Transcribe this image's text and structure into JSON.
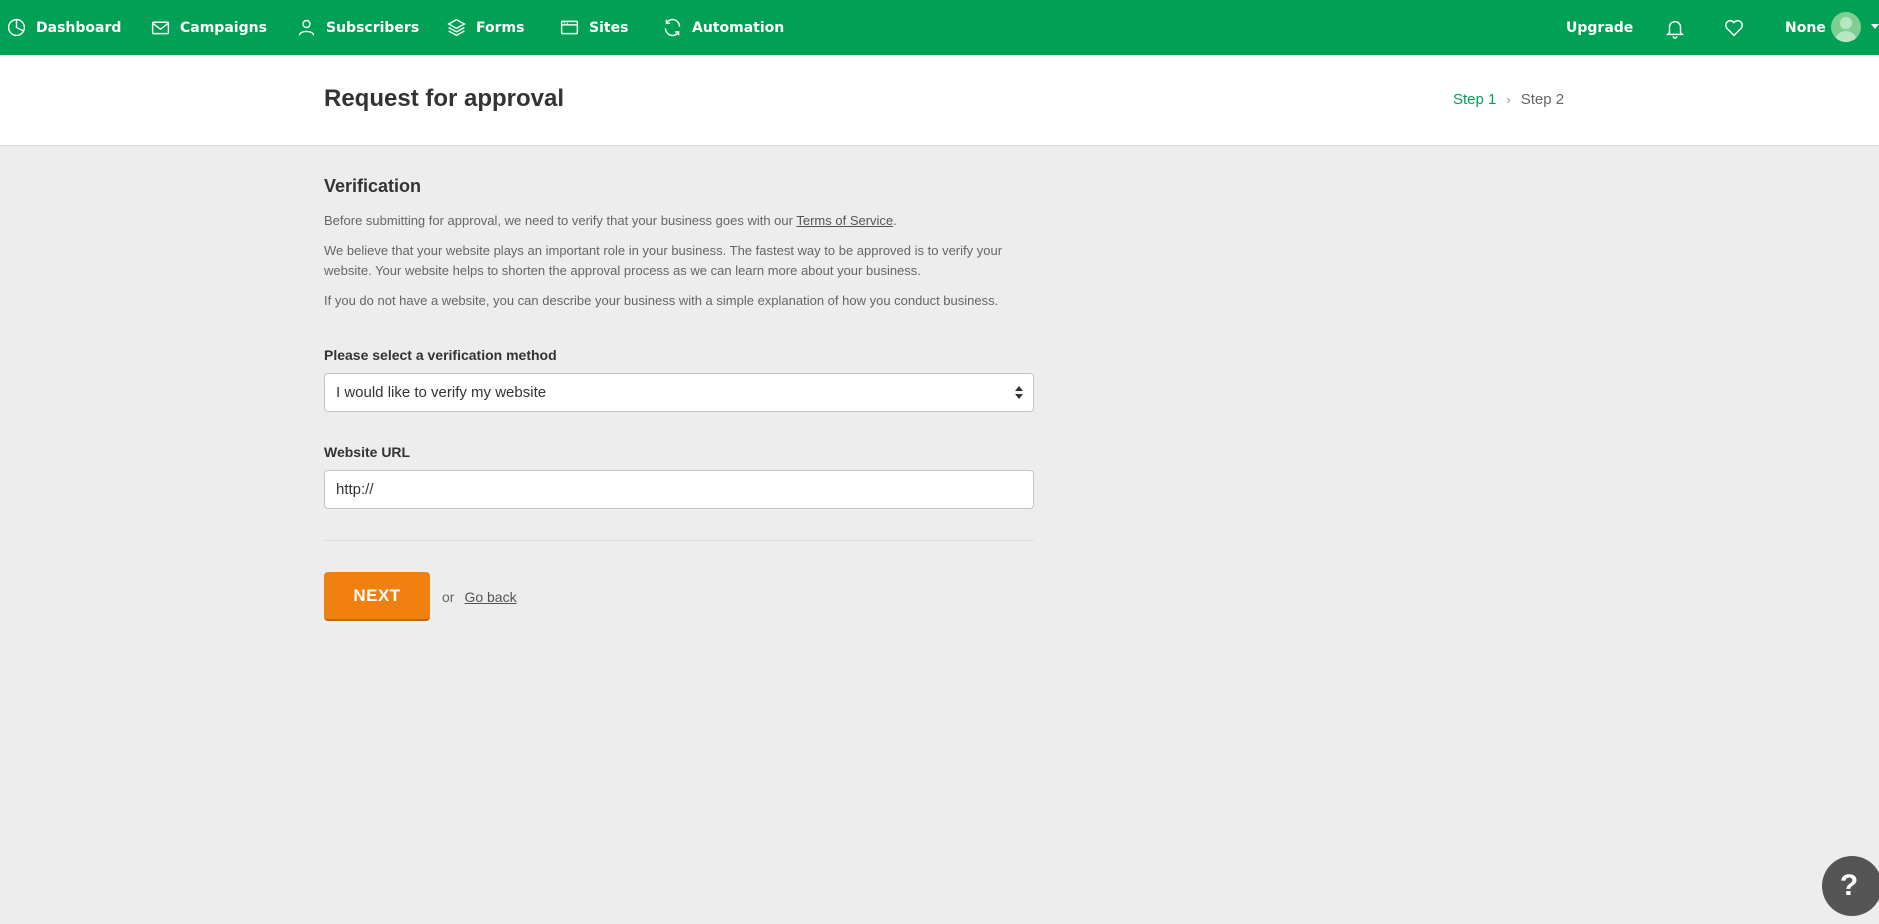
{
  "nav": {
    "items": [
      {
        "label": "Dashboard",
        "icon": "pie-chart-icon"
      },
      {
        "label": "Campaigns",
        "icon": "envelope-icon"
      },
      {
        "label": "Subscribers",
        "icon": "person-icon"
      },
      {
        "label": "Forms",
        "icon": "layers-icon"
      },
      {
        "label": "Sites",
        "icon": "browser-window-icon"
      },
      {
        "label": "Automation",
        "icon": "refresh-icon"
      }
    ],
    "upgrade_label": "Upgrade",
    "user_name": "None"
  },
  "header": {
    "title": "Request for approval",
    "step1": "Step 1",
    "step2": "Step 2"
  },
  "verification": {
    "title": "Verification",
    "para1_prefix": "Before submitting for approval, we need to verify that your business goes with our ",
    "tos_link": "Terms of Service",
    "para1_suffix": ".",
    "para2": "We believe that your website plays an important role in your business. The fastest way to be approved is to verify your website. Your website helps to shorten the approval process as we can learn more about your business.",
    "para3": "If you do not have a website, you can describe your business with a simple explanation of how you conduct business."
  },
  "form": {
    "method_label": "Please select a verification method",
    "method_value": "I would like to verify my website",
    "url_label": "Website URL",
    "url_value": "http://"
  },
  "actions": {
    "next_label": "NEXT",
    "or_text": "or",
    "back_label": "Go back"
  },
  "help": {
    "label": "?"
  },
  "colors": {
    "brand_green": "#00a154",
    "accent_orange": "#f0800f"
  }
}
